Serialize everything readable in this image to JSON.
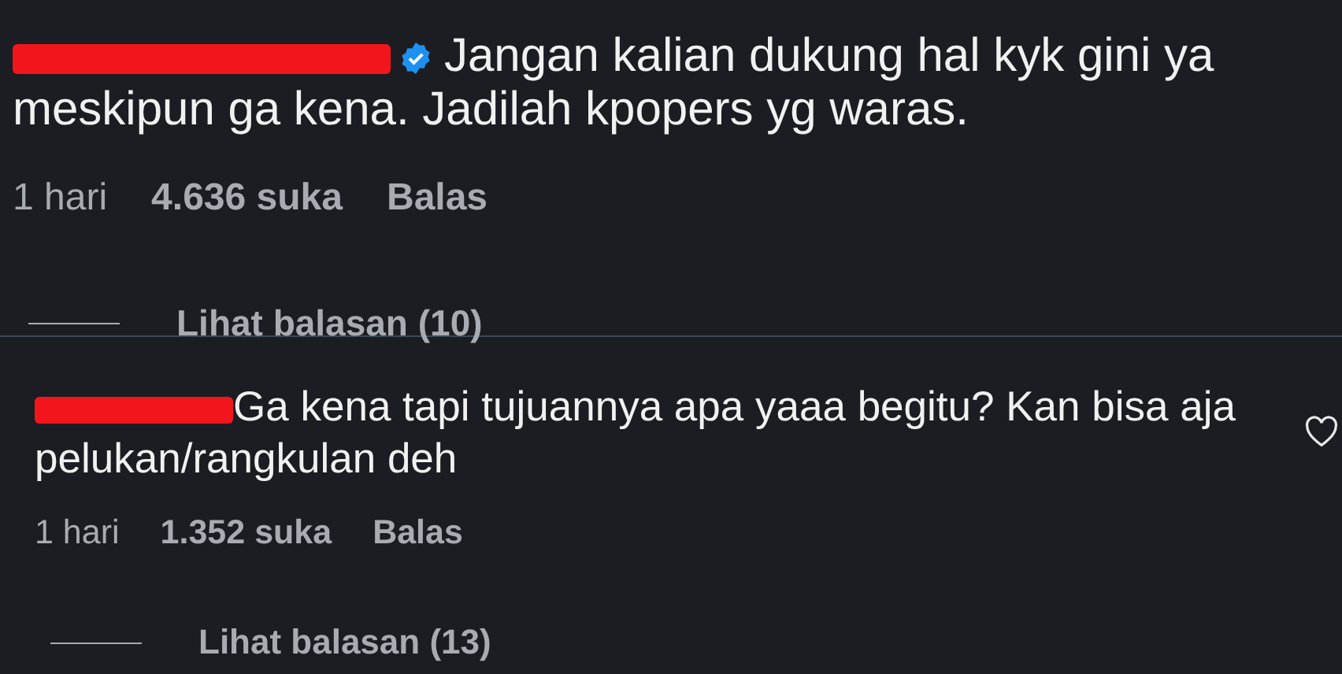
{
  "comments": [
    {
      "verified": true,
      "text": "Jangan kalian dukung hal kyk gini ya meskipun ga kena. Jadilah kpopers yg waras.",
      "time": "1 hari",
      "likes": "4.636 suka",
      "reply": "Balas",
      "view_replies": "Lihat balasan (10)",
      "like_button": false
    },
    {
      "verified": false,
      "text": "Ga kena tapi tujuannya apa yaaa begitu? Kan bisa aja pelukan/rangkulan deh",
      "time": "1 hari",
      "likes": "1.352 suka",
      "reply": "Balas",
      "view_replies": "Lihat balasan (13)",
      "like_button": true
    }
  ]
}
